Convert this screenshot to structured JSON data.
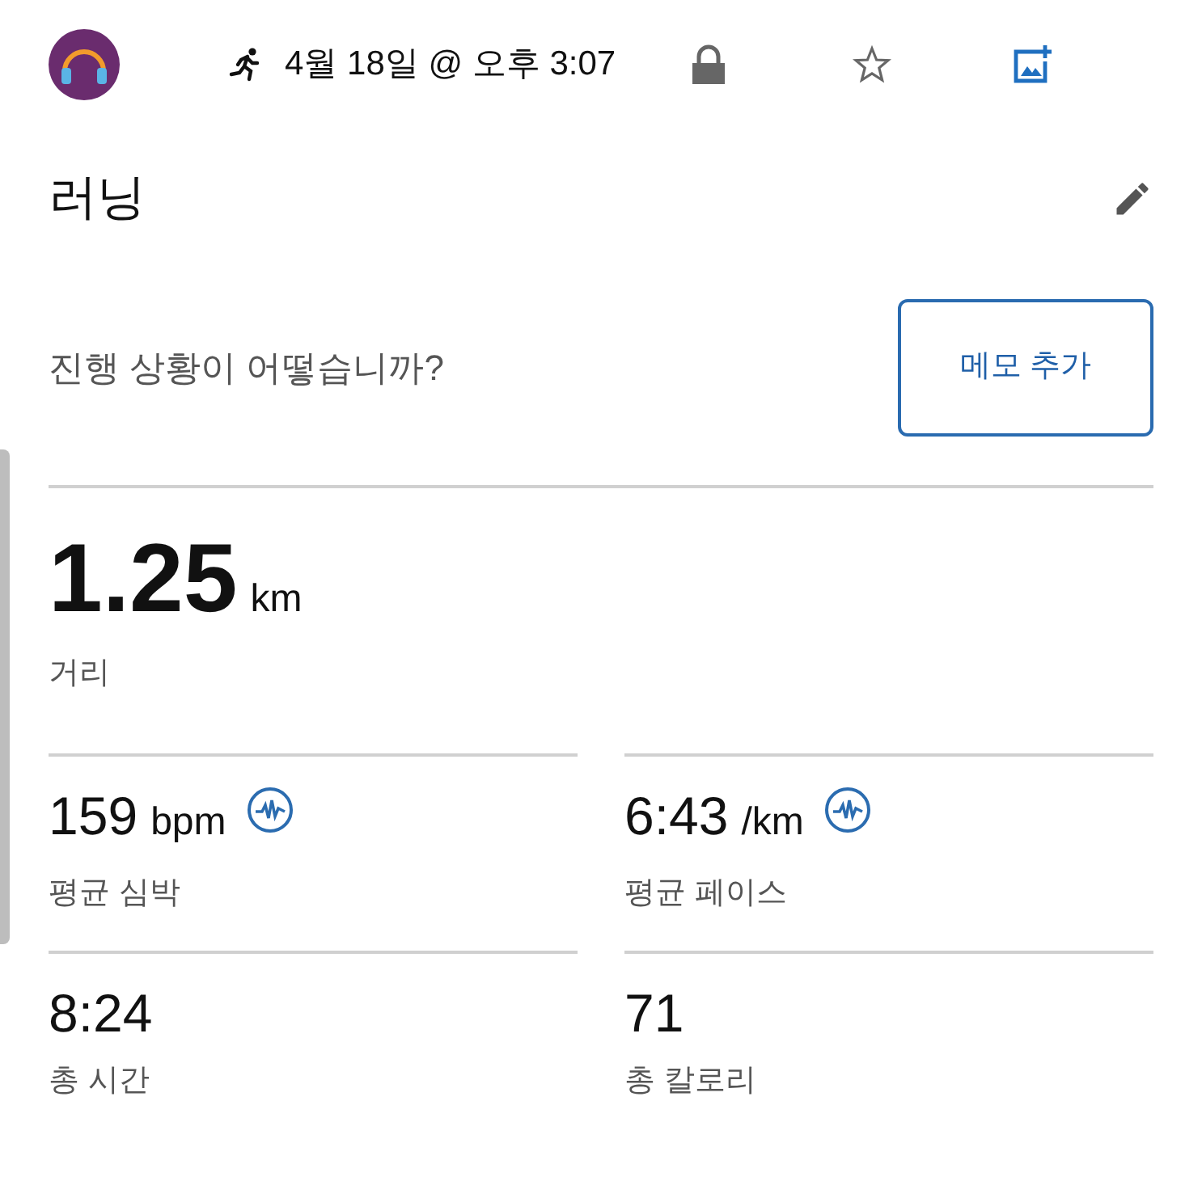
{
  "header": {
    "date": "4월 18일 @ 오후 3:07",
    "locked": true,
    "favorite": false
  },
  "activity": {
    "title": "러닝",
    "prompt": "진행 상황이 어떻습니까?",
    "memo_button": "메모 추가"
  },
  "distance": {
    "value": "1.25",
    "unit": "km",
    "label": "거리"
  },
  "metrics": [
    {
      "kind": "trend",
      "value": "159",
      "unit": "bpm",
      "label": "평균 심박"
    },
    {
      "kind": "trend",
      "value": "6:43",
      "unit": "/km",
      "label": "평균 페이스"
    },
    {
      "kind": "plain",
      "value": "8:24",
      "label": "총 시간"
    },
    {
      "kind": "plain",
      "value": "71",
      "label": "총 칼로리"
    }
  ]
}
